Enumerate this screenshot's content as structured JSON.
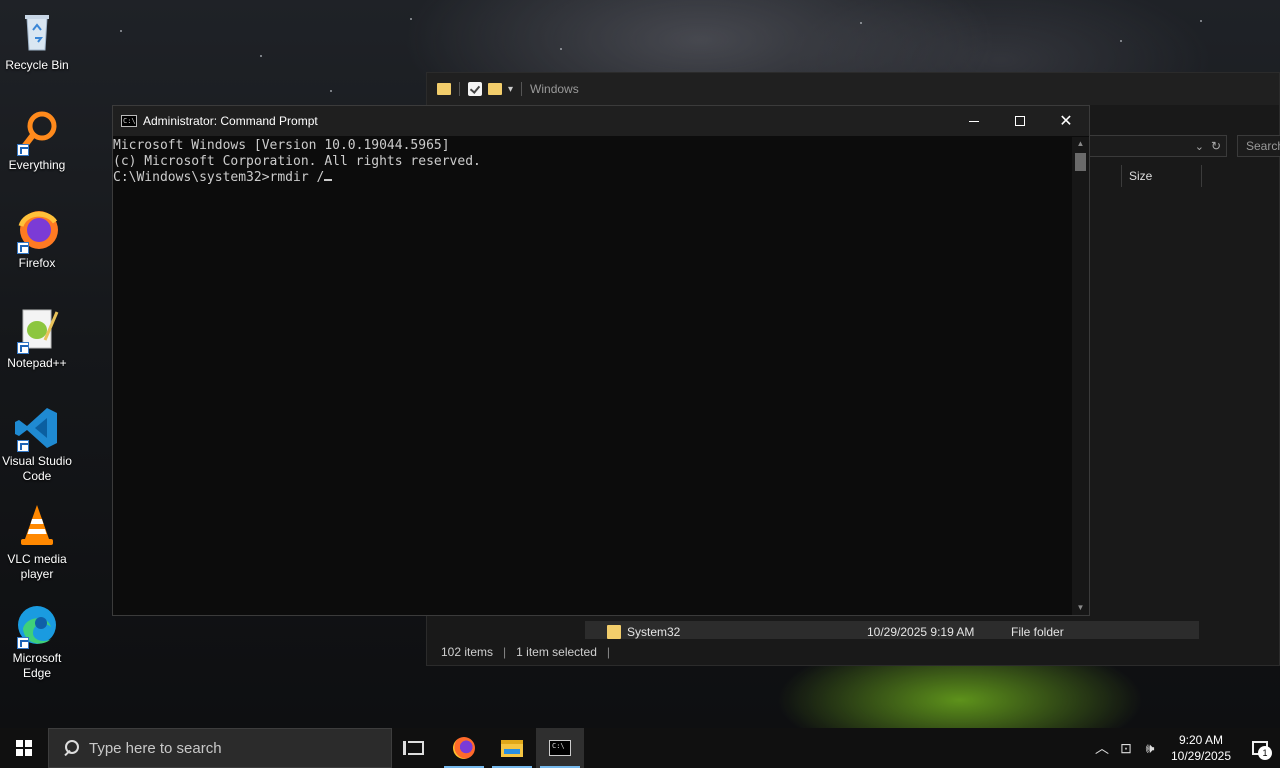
{
  "desktop": {
    "icons": [
      {
        "label": "Recycle Bin"
      },
      {
        "label": "Everything"
      },
      {
        "label": "Firefox"
      },
      {
        "label": "Notepad++"
      },
      {
        "label": "Visual Studio Code"
      },
      {
        "label": "VLC media player"
      },
      {
        "label": "Microsoft Edge"
      }
    ]
  },
  "explorer": {
    "title": "Windows",
    "search_placeholder": "Search",
    "column_size": "Size",
    "selected_row": {
      "name": "System32",
      "date": "10/29/2025 9:19 AM",
      "type": "File folder"
    },
    "status_items": "102 items",
    "status_selected": "1 item selected",
    "status_sep": "|"
  },
  "cmd": {
    "title": "Administrator: Command Prompt",
    "icon_text": "C:\\",
    "lines": [
      "Microsoft Windows [Version 10.0.19044.5965]",
      "(c) Microsoft Corporation. All rights reserved.",
      "",
      "C:\\Windows\\system32>rmdir /"
    ]
  },
  "taskbar": {
    "search_placeholder": "Type here to search",
    "time": "9:20 AM",
    "date": "10/29/2025",
    "notification_count": "1"
  }
}
